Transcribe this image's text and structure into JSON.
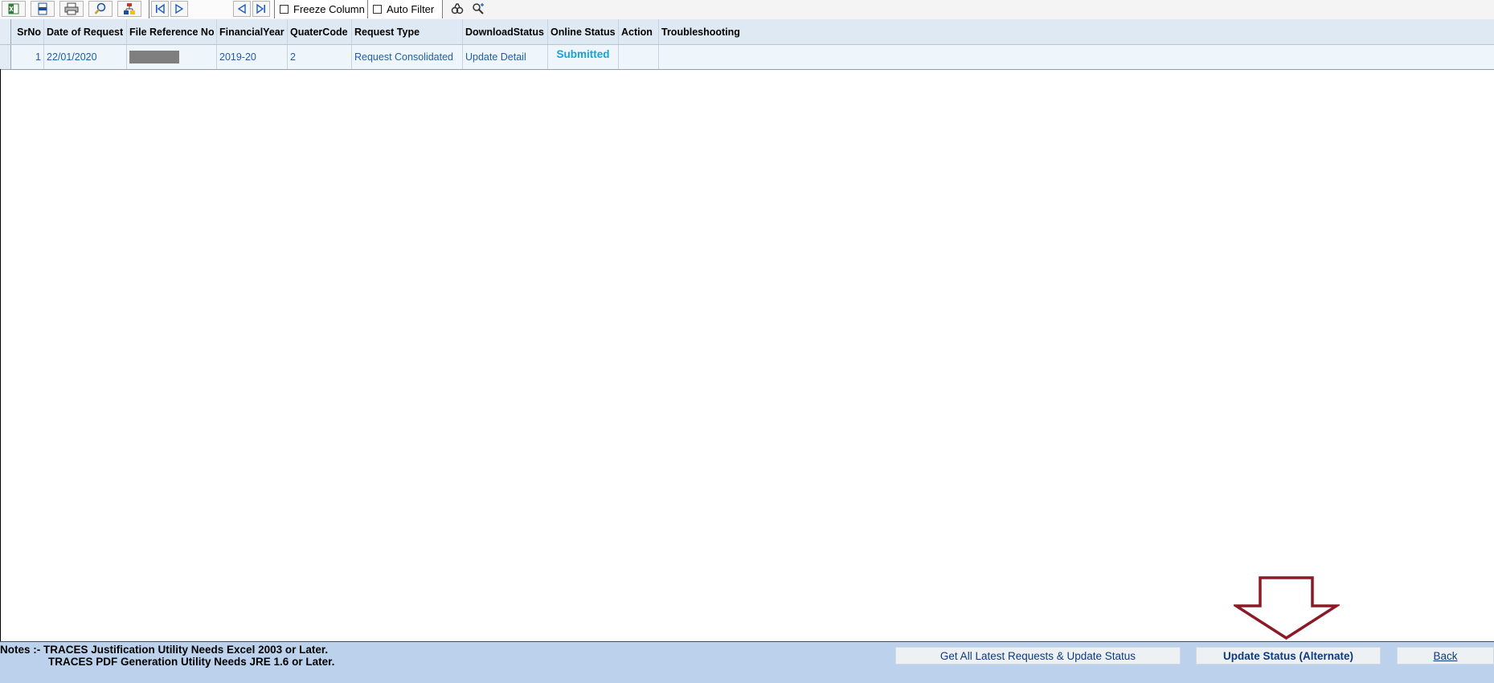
{
  "toolbar": {
    "buttons": [
      {
        "icon": "excel-export-icon"
      },
      {
        "icon": "csv-export-icon"
      },
      {
        "icon": "print-icon"
      },
      {
        "icon": "print-preview-icon"
      },
      {
        "icon": "column-chooser-icon"
      },
      {
        "icon": "first-page-icon"
      },
      {
        "icon": "next-page-icon"
      },
      {
        "icon": "previous-page-icon"
      },
      {
        "icon": "last-page-icon"
      },
      {
        "icon": "find-icon"
      },
      {
        "icon": "find-next-icon"
      }
    ],
    "freeze_column_label": "Freeze Column",
    "freeze_column_checked": false,
    "auto_filter_label": "Auto Filter",
    "auto_filter_checked": false
  },
  "grid": {
    "columns": [
      "SrNo",
      "Date of Request",
      "File Reference No",
      "FinancialYear",
      "QuaterCode",
      "Request Type",
      "DownloadStatus",
      "Online Status",
      "Action",
      "Troubleshooting"
    ],
    "rows": [
      {
        "srno": "1",
        "date": "22/01/2020",
        "file_ref": "",
        "financial_year": "2019-20",
        "quarter_code": "2",
        "request_type": "Request Consolidated",
        "download_status": "Update Detail",
        "online_status": "Submitted",
        "action": "",
        "troubleshooting": ""
      }
    ]
  },
  "footer": {
    "note_line1": "Notes :- TRACES Justification Utility Needs Excel 2003 or Later.",
    "note_line2": "TRACES PDF Generation Utility Needs JRE 1.6 or Later.",
    "get_all_label": "Get All Latest Requests & Update Status",
    "update_alt_label": "Update Status (Alternate)",
    "back_label": "Back"
  },
  "colors": {
    "header_bg": "#dfe9f3",
    "row_bg": "#eef5fb",
    "link_blue": "#1f5fa6",
    "submitted": "#19a1d8",
    "footer_bg": "#bcd2ec",
    "arrow": "#8b1a24"
  }
}
